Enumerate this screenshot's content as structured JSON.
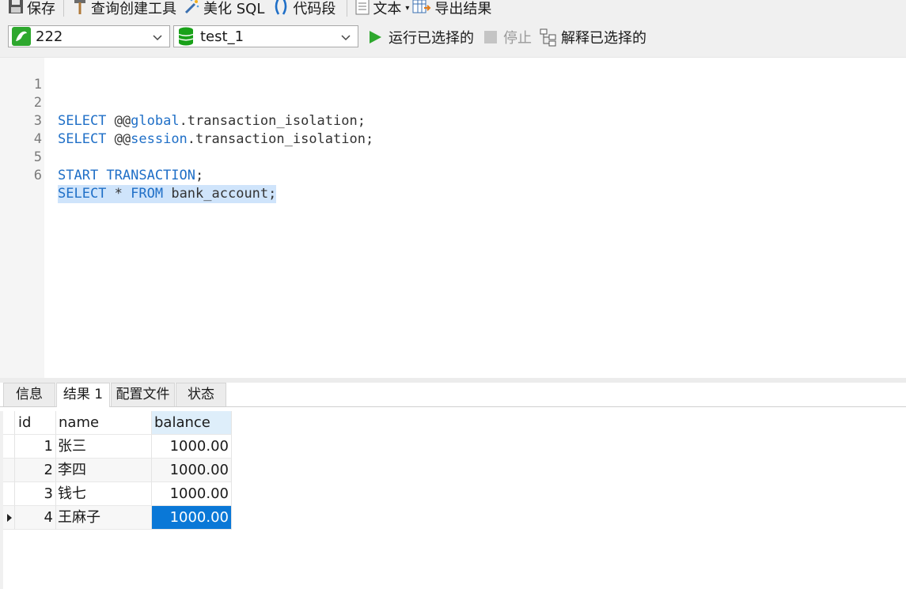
{
  "toolbar": {
    "save_label": "保存",
    "query_builder_label": "查询创建工具",
    "beautify_label": "美化 SQL",
    "snippet_label": "代码段",
    "text_label": "文本",
    "export_label": "导出结果"
  },
  "connection": {
    "value": "222"
  },
  "database": {
    "value": "test_1"
  },
  "actions": {
    "run_selected": "运行已选择的",
    "stop": "停止",
    "explain_selected": "解释已选择的"
  },
  "editor": {
    "line_numbers": [
      "1",
      "2",
      "3",
      "4",
      "5",
      "6"
    ],
    "lines": {
      "l2_kw": "SELECT",
      "l2_at": " @@",
      "l2_var": "global",
      "l2_rest": ".transaction_isolation;",
      "l3_kw": "SELECT",
      "l3_at": " @@",
      "l3_var": "session",
      "l3_rest": ".transaction_isolation;",
      "l5_kw": "START TRANSACTION",
      "l5_rest": ";",
      "l6_kw1": "SELECT",
      "l6_star": " * ",
      "l6_kw2": "FROM",
      "l6_rest": " bank_account;"
    }
  },
  "tabs": [
    {
      "label": "信息"
    },
    {
      "label": "结果 1"
    },
    {
      "label": "配置文件"
    },
    {
      "label": "状态"
    }
  ],
  "results": {
    "columns": [
      "id",
      "name",
      "balance"
    ],
    "rows": [
      {
        "id": "1",
        "name": "张三",
        "balance": "1000.00"
      },
      {
        "id": "2",
        "name": "李四",
        "balance": "1000.00"
      },
      {
        "id": "3",
        "name": "钱七",
        "balance": "1000.00"
      },
      {
        "id": "4",
        "name": "王麻子",
        "balance": "1000.00"
      }
    ],
    "selected_row": 4
  },
  "colors": {
    "keyword": "#1f6fc7",
    "selection": "#0a78d7",
    "run_green": "#2ea82e",
    "db_green": "#19a119"
  }
}
